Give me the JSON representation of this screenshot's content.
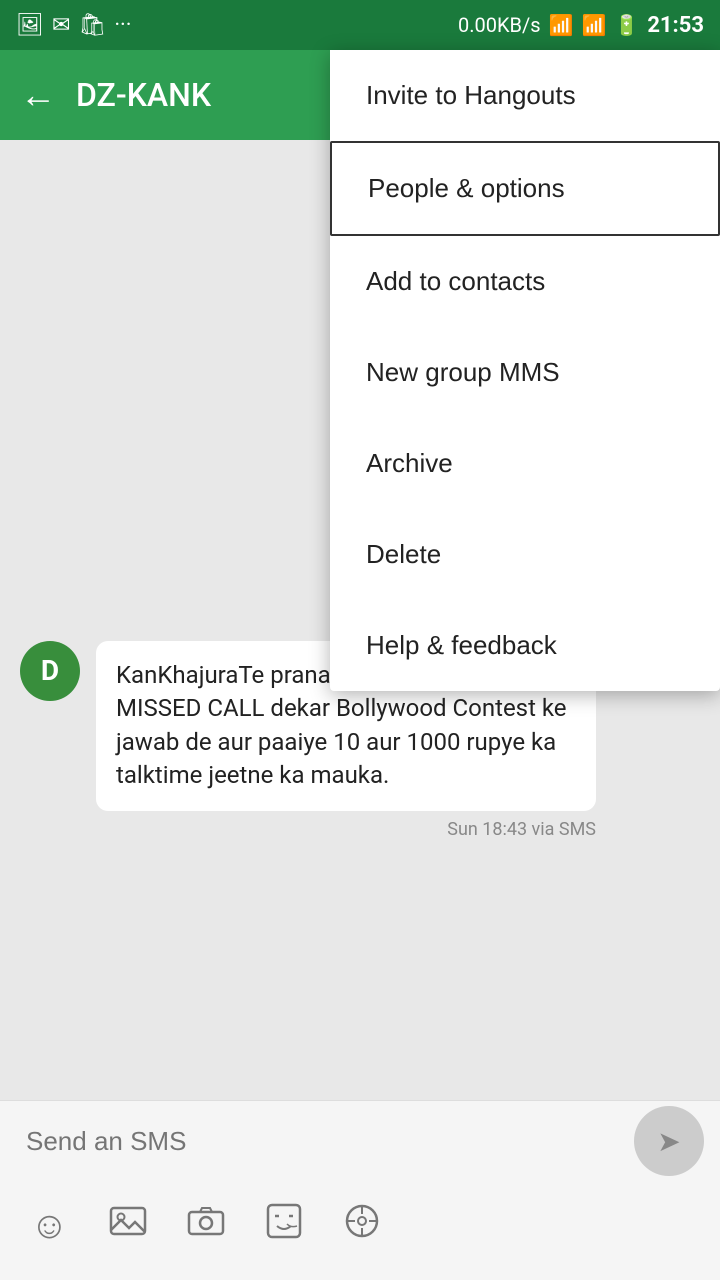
{
  "statusBar": {
    "speed": "0.00KB/s",
    "time": "21:53",
    "icons": [
      "image-icon",
      "email-icon",
      "bag-icon",
      "more-icon",
      "wifi-icon",
      "signal-icon",
      "battery-icon"
    ]
  },
  "appBar": {
    "backLabel": "←",
    "title": "DZ-KANK"
  },
  "menu": {
    "items": [
      {
        "id": "invite",
        "label": "Invite to Hangouts"
      },
      {
        "id": "people",
        "label": "People & options",
        "highlighted": true
      },
      {
        "id": "add",
        "label": "Add to contacts"
      },
      {
        "id": "group",
        "label": "New group MMS"
      },
      {
        "id": "archive",
        "label": "Archive"
      },
      {
        "id": "delete",
        "label": "Delete"
      },
      {
        "id": "help",
        "label": "Help & feedback"
      }
    ]
  },
  "message": {
    "avatar": "D",
    "text": "KanKhajuraTe pranam 1800300001230 pe MISSED CALL dekar Bollywood Contest ke jawab de aur paaiye 10 aur 1000 rupye ka talktime jeetne ka mauka.",
    "time": "Sun 18:43 via SMS"
  },
  "inputBar": {
    "placeholder": "Send an SMS",
    "sendIcon": "➤",
    "icons": [
      {
        "name": "emoji-icon",
        "symbol": "☺"
      },
      {
        "name": "image-icon",
        "symbol": "🖼"
      },
      {
        "name": "camera-icon",
        "symbol": "📷"
      },
      {
        "name": "sticker-icon",
        "symbol": "🎭"
      },
      {
        "name": "location-icon",
        "symbol": "◎"
      }
    ]
  }
}
